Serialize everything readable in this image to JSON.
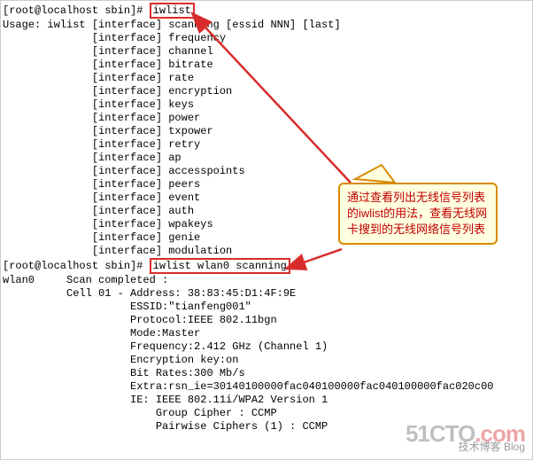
{
  "prompt1_prefix": "[root@localhost sbin]# ",
  "cmd1": "iwlist",
  "usage_line": "Usage: iwlist [interface] scanning [essid NNN] [last]",
  "options": [
    "[interface] frequency",
    "[interface] channel",
    "[interface] bitrate",
    "[interface] rate",
    "[interface] encryption",
    "[interface] keys",
    "[interface] power",
    "[interface] txpower",
    "[interface] retry",
    "[interface] ap",
    "[interface] accesspoints",
    "[interface] peers",
    "[interface] event",
    "[interface] auth",
    "[interface] wpakeys",
    "[interface] genie",
    "[interface] modulation"
  ],
  "prompt2_prefix": "[root@localhost sbin]# ",
  "cmd2": "iwlist wlan0 scanning",
  "scan_header": "wlan0     Scan completed :",
  "cell_header": "          Cell 01 - Address: 38:83:45:D1:4F:9E",
  "cell_details": [
    "                    ESSID:\"tianfeng001\"",
    "                    Protocol:IEEE 802.11bgn",
    "                    Mode:Master",
    "                    Frequency:2.412 GHz (Channel 1)",
    "                    Encryption key:on",
    "                    Bit Rates:300 Mb/s",
    "                    Extra:rsn_ie=30140100000fac040100000fac040100000fac020c00",
    "                    IE: IEEE 802.11i/WPA2 Version 1",
    "                        Group Cipher : CCMP",
    "                        Pairwise Ciphers (1) : CCMP"
  ],
  "callout_text": "通过查看列出无线信号列表的iwlist的用法，查看无线网卡搜到的无线网络信号列表",
  "watermark_main": "51CTO",
  "watermark_suffix": ".com",
  "watermark_sub": "技术博客    Blog"
}
